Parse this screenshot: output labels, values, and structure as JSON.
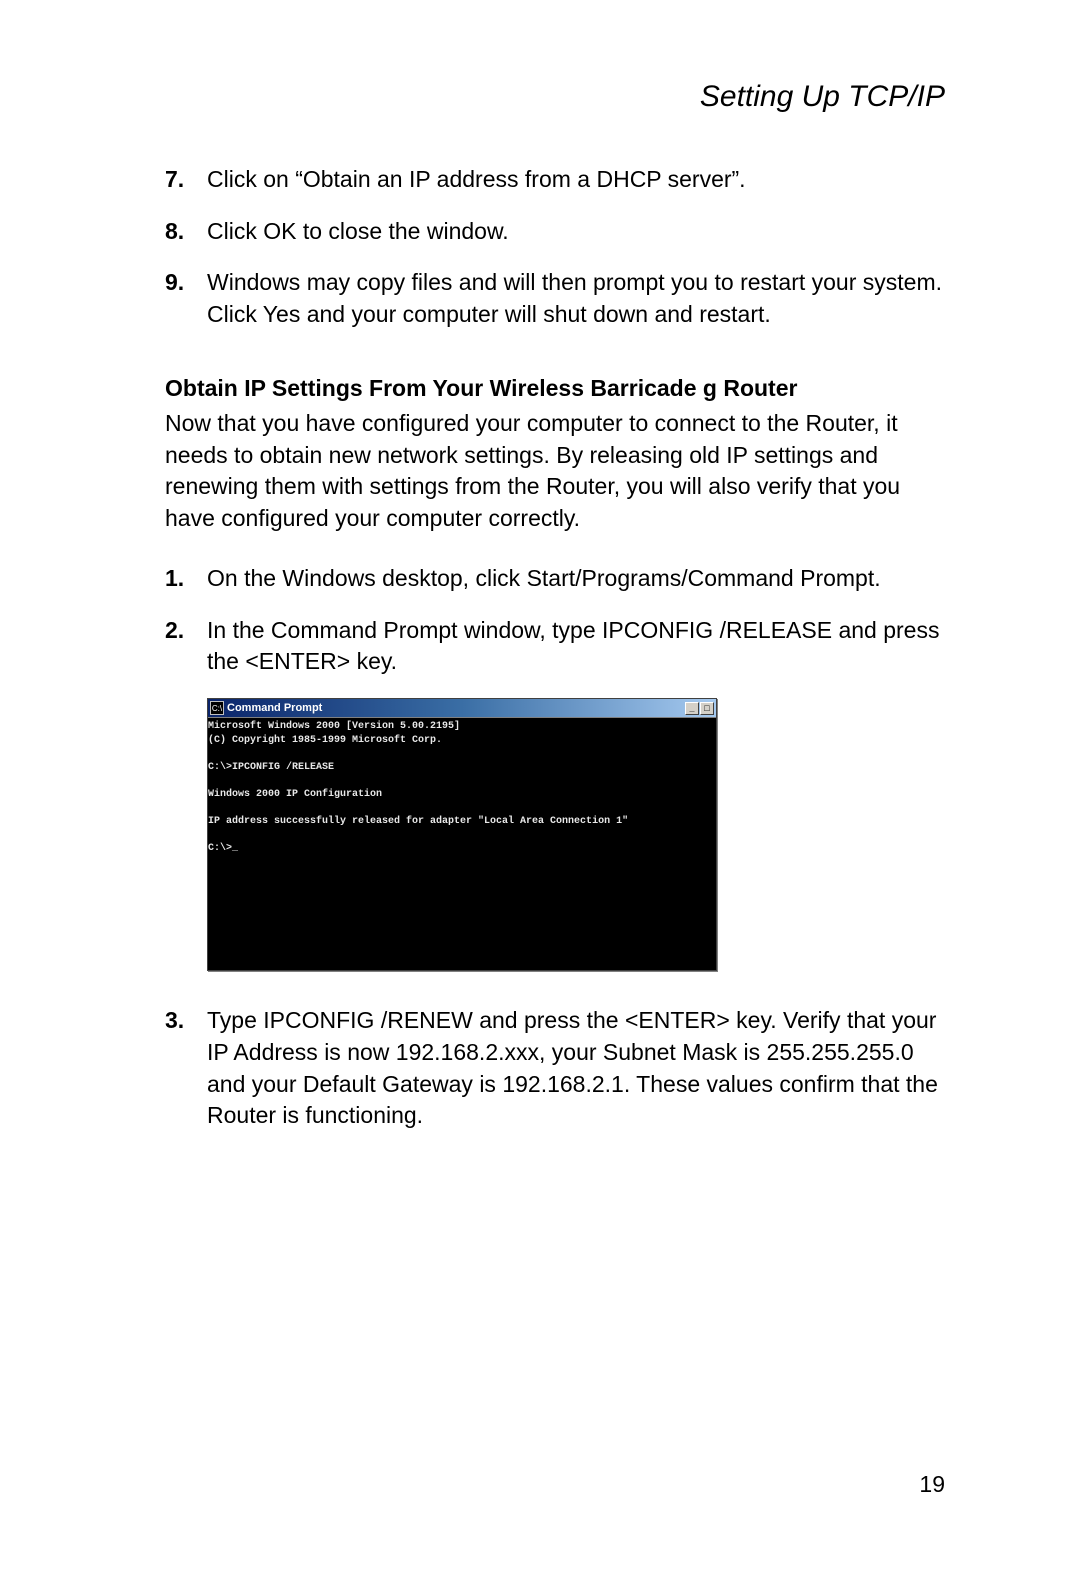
{
  "header": {
    "title": "Setting Up TCP/IP"
  },
  "listA": {
    "items": [
      {
        "num": "7.",
        "text": "Click on “Obtain an IP address from a DHCP server”."
      },
      {
        "num": "8.",
        "text": "Click OK to close the window."
      },
      {
        "num": "9.",
        "text": "Windows may copy files and will then prompt you to restart your system. Click Yes and your computer will shut down and restart."
      }
    ]
  },
  "section": {
    "heading": "Obtain IP Settings From Your Wireless Barricade g Router",
    "intro": "Now that you have configured your computer to connect to the Router, it needs to obtain new network settings. By releasing old IP settings and renewing them with settings from the Router, you will also verify that you have configured your computer correctly."
  },
  "listB": {
    "items": [
      {
        "num": "1.",
        "text": "On the Windows desktop, click Start/Programs/Command Prompt."
      },
      {
        "num": "2.",
        "text": "In the Command Prompt window, type IPCONFIG /RELEASE and press the <ENTER> key."
      }
    ]
  },
  "cmd": {
    "title": "Command Prompt",
    "icon_label": "C:\\",
    "buttons": {
      "min": "_",
      "max": "□"
    },
    "lines": [
      "Microsoft Windows 2000 [Version 5.00.2195]",
      "(C) Copyright 1985-1999 Microsoft Corp.",
      "",
      "C:\\>IPCONFIG /RELEASE",
      "",
      "Windows 2000 IP Configuration",
      "",
      "IP address successfully released for adapter \"Local Area Connection 1\"",
      "",
      "C:\\>_"
    ]
  },
  "listC": {
    "items": [
      {
        "num": "3.",
        "text": "Type IPCONFIG /RENEW and press the <ENTER> key. Verify that your IP Address is now 192.168.2.xxx, your Subnet Mask is 255.255.255.0 and your Default Gateway is 192.168.2.1. These values confirm that the Router is functioning."
      }
    ]
  },
  "pageNumber": "19"
}
